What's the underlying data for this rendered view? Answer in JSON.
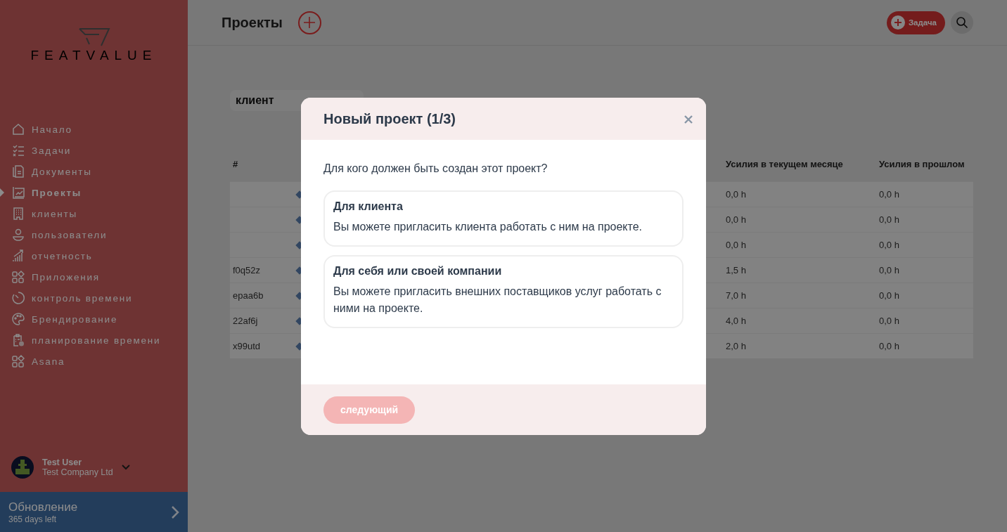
{
  "sidebar": {
    "logo": "FEATVALUE",
    "items": [
      {
        "label": "Начало",
        "selected": false
      },
      {
        "label": "Задачи",
        "selected": false
      },
      {
        "label": "Документы",
        "selected": false
      },
      {
        "label": "Проекты",
        "selected": true
      },
      {
        "label": "клиенты",
        "selected": false
      },
      {
        "label": "пользователи",
        "selected": false
      },
      {
        "label": "отчетность",
        "selected": false
      },
      {
        "label": "Приложения",
        "selected": false
      },
      {
        "label": "контроль времени",
        "selected": false
      },
      {
        "label": "Брендирование",
        "selected": false
      },
      {
        "label": "планирование времени",
        "selected": false
      },
      {
        "label": "Asana",
        "selected": false
      }
    ],
    "user": {
      "name": "Test User",
      "company": "Test Company Ltd"
    },
    "upgrade": {
      "title": "Обновление",
      "subtitle": "365 days left"
    }
  },
  "header": {
    "title": "Проекты",
    "task_button": "Задача"
  },
  "filter": {
    "value": "клиент"
  },
  "table": {
    "columns": [
      "#",
      "Усилия в текущем месяце",
      "Усилия в прошлом"
    ],
    "rows": [
      {
        "id": "",
        "current": "0,0 h",
        "previous": "0,0 h"
      },
      {
        "id": "",
        "current": "0,0 h",
        "previous": "0,0 h"
      },
      {
        "id": "",
        "current": "0,0 h",
        "previous": "0,0 h"
      },
      {
        "id": "f0q52z",
        "current": "1,5 h",
        "previous": "0,0 h"
      },
      {
        "id": "epaa6b",
        "current": "7,0 h",
        "previous": "0,0 h"
      },
      {
        "id": "22af6j",
        "current": "4,0 h",
        "previous": "0,0 h"
      },
      {
        "id": "x99utd",
        "current": "2,0 h",
        "previous": "0,0 h"
      }
    ]
  },
  "dialog": {
    "title": "Новый проект (1/3)",
    "question": "Для кого должен быть создан этот проект?",
    "options": [
      {
        "title": "Для клиента",
        "description": "Вы можете пригласить клиента работать с ним на проекте.",
        "selected": false
      },
      {
        "title": "Для себя или своей компании",
        "description": "Вы можете пригласить внешних поставщиков услуг работать с ними на проекте.",
        "selected": false
      }
    ],
    "next_button": {
      "label": "следующий",
      "disabled": true
    }
  }
}
